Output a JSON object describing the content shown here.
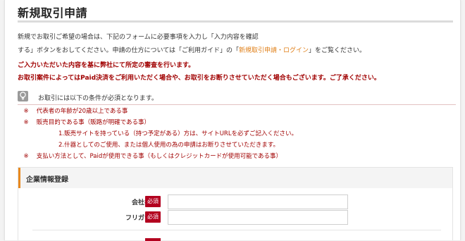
{
  "page": {
    "title": "新規取引申請"
  },
  "intro": {
    "line1": "新規でお取引ご希望の場合は、下記のフォームに必要事項を入力し「入力内容を確認",
    "line2_before": "する」ボタンをおしてください。申請の仕方については「ご利用ガイド」の「",
    "guide_link": "新規取引申請・ログイン",
    "line2_after": "」をご覧ください。"
  },
  "notice": {
    "line1": "ご入力いただいた内容を基に弊社にて所定の審査を行います。",
    "line2": "お取引案件によってはPaid決済をご利用いただく場合や、お取引をお断りさせていただく場合もございます。ご了承ください。"
  },
  "conditions": {
    "heading": "お取引には以下の条件が必須となります。",
    "items": [
      {
        "mark": "※",
        "text": "代表者の年齢が20歳以上である事"
      },
      {
        "mark": "※",
        "text": "販売目的である事（販路が明確である事）"
      },
      {
        "mark": "",
        "text": "1.販売サイトを持っている（持つ予定がある）方は、サイトURLを必ずご記入ください。"
      },
      {
        "mark": "",
        "text": "2.什器としてのご使用、または個人使用の為の申請はお断りさせていただきます。"
      },
      {
        "mark": "※",
        "text": "支払い方法として、Paidが使用できる事（もしくはクレジットカードが使用可能である事）"
      }
    ]
  },
  "section": {
    "title": "企業情報登録",
    "fields": [
      {
        "label": "会社名",
        "required": "必須",
        "value": ""
      },
      {
        "label": "フリガナ",
        "required": "必須",
        "value": ""
      }
    ]
  },
  "colors": {
    "accent": "#e8891f",
    "notice": "#a00000",
    "badge": "#b3001f"
  }
}
